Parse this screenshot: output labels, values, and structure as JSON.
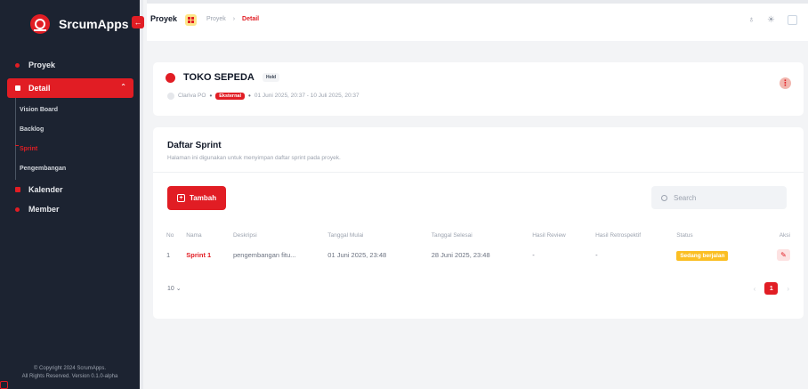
{
  "app": {
    "name": "SrcumApps"
  },
  "sidebar": {
    "items": [
      {
        "label": "Proyek"
      },
      {
        "label": "Detail"
      },
      {
        "label": "Kalender"
      },
      {
        "label": "Member"
      }
    ],
    "sub_items": [
      {
        "label": "Vision Board"
      },
      {
        "label": "Backlog"
      },
      {
        "label": "Sprint"
      },
      {
        "label": "Pengembangan"
      }
    ],
    "copyright_line1": "© Copyright 2024 ScrumApps.",
    "copyright_line2": "All Rights Reserved. Version 0.1.0-alpha"
  },
  "header": {
    "title": "Proyek",
    "breadcrumb": [
      "Proyek",
      "Detail"
    ]
  },
  "project": {
    "name": "TOKO SEPEDA",
    "status": "Hold",
    "owner": "Clariva PO",
    "type": "Eksternal",
    "date_range": "01 Juni 2025, 20:37 - 10 Juli 2025, 20:37"
  },
  "sprint_section": {
    "title": "Daftar Sprint",
    "subtitle": "Halaman ini digunakan untuk menyimpan daftar sprint pada proyek.",
    "add_label": "Tambah",
    "search_placeholder": "Search",
    "columns": [
      "No",
      "Nama",
      "Deskripsi",
      "Tanggal Mulai",
      "Tanggal Selesai",
      "Hasil Review",
      "Hasil Retrospektif",
      "Status",
      "Aksi"
    ],
    "rows": [
      {
        "no": "1",
        "name": "Sprint 1",
        "description": "pengembangan fitu...",
        "start": "01 Juni 2025, 23:48",
        "end": "28 Juni 2025, 23:48",
        "review": "-",
        "retro": "-",
        "status": "Sedang berjalan"
      }
    ],
    "per_page": "10",
    "current_page": "1"
  },
  "colors": {
    "accent": "#e11d24",
    "sidebar_bg": "#1c2331",
    "status_warning": "#fbbf24"
  }
}
